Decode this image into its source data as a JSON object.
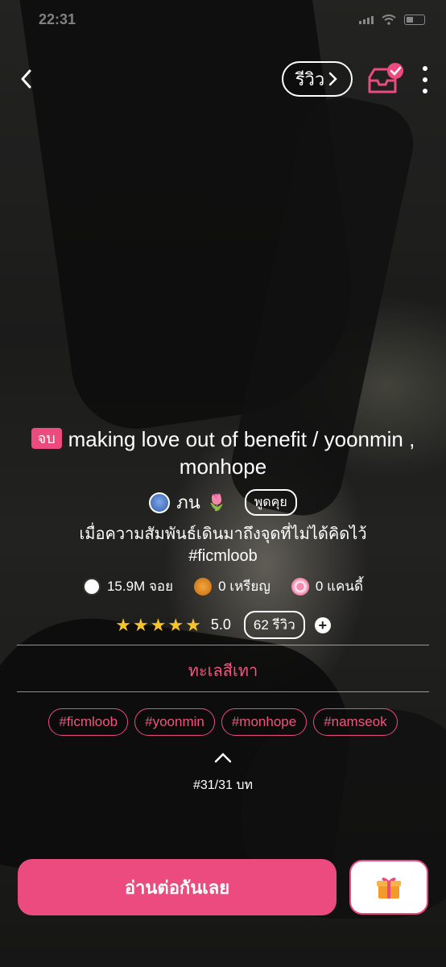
{
  "status_bar": {
    "time": "22:31"
  },
  "nav": {
    "review_label": "รีวิว"
  },
  "novel": {
    "status_badge": "จบ",
    "title": "making love out of benefit / yoonmin , monhope",
    "author": "ภน",
    "talk_label": "พูดคุย",
    "description_line1": "เมื่อความสัมพันธ์เดินมาถึงจุดที่ไม่ได้คิดไว้",
    "description_line2": "#ficmloob"
  },
  "stats": {
    "views": "15.9M จอย",
    "coins": "0 เหรียญ",
    "candy": "0 แคนดี้"
  },
  "rating": {
    "stars": "★★★★★",
    "value": "5.0",
    "review_count": "62 รีวิว"
  },
  "category": "ทะเลสีเทา",
  "tags": [
    "#ficmloob",
    "#yoonmin",
    "#monhope",
    "#namseok"
  ],
  "chapter": "#31/31 บท",
  "actions": {
    "read_label": "อ่านต่อกันเลย"
  },
  "colors": {
    "accent": "#eb4b7f",
    "star": "#f5c32b"
  }
}
